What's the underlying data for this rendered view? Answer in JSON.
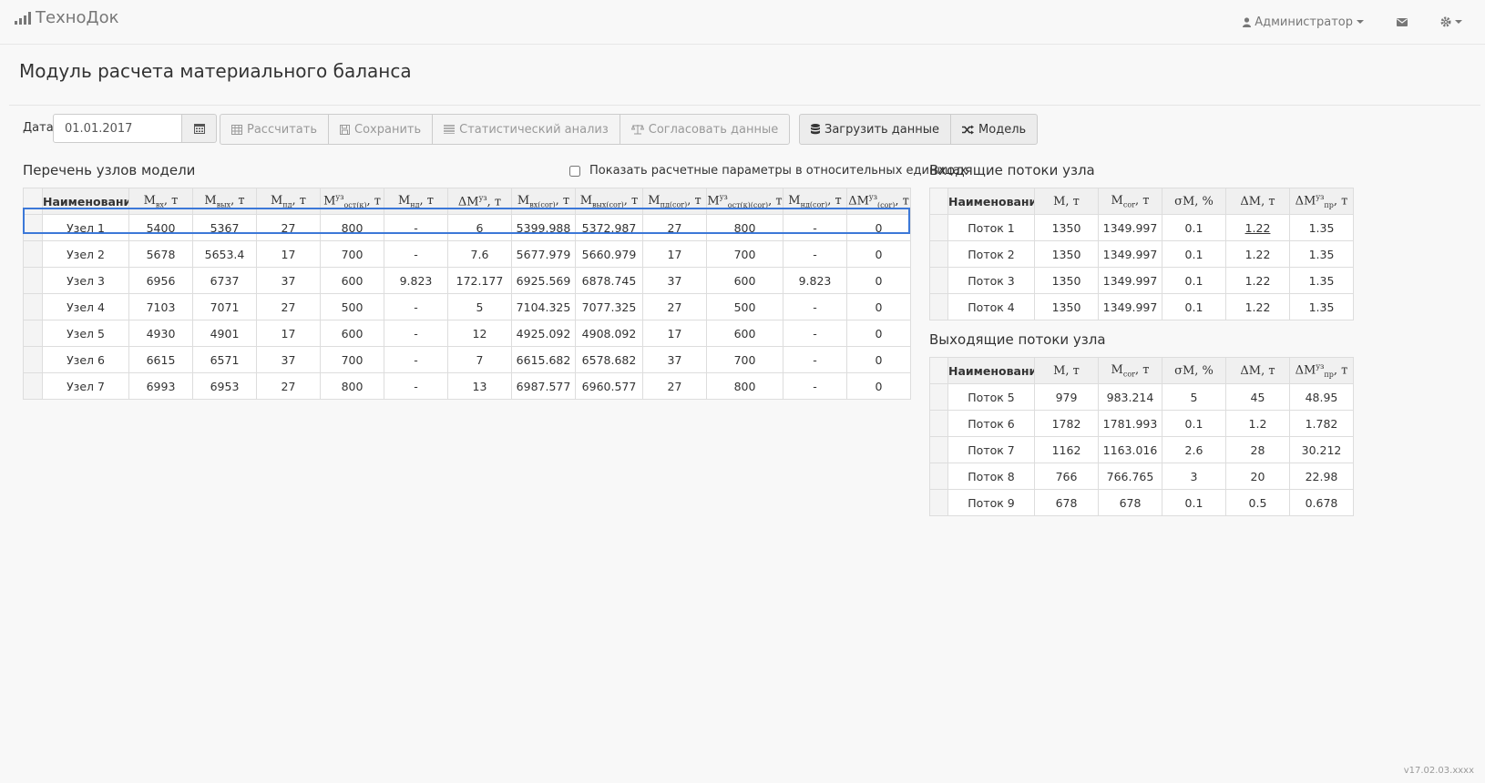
{
  "navbar": {
    "brand": "ТехноДок",
    "user_label": "Администратор",
    "mail_icon": "envelope-icon",
    "settings_icon": "gear-icon"
  },
  "page": {
    "title": "Модуль расчета материального баланса"
  },
  "toolbar": {
    "date_label": "Дата",
    "date_value": "01.01.2017",
    "calc_label": "Рассчитать",
    "save_label": "Сохранить",
    "stat_label": "Статистический анализ",
    "reconcile_label": "Согласовать данные",
    "load_label": "Загрузить данные",
    "model_label": "Модель"
  },
  "nodes": {
    "title": "Перечень узлов модели",
    "relative_checkbox_label": "Показать расчетные параметры в относительных единицах",
    "rows": [
      {
        "name": "Узел 1",
        "m_in": "5400",
        "m_out": "5367",
        "m_pd": "27",
        "m_ost": "800",
        "m_nd": "-",
        "dm": "6",
        "m_in_cor": "5399.988",
        "m_out_cor": "5372.987",
        "m_pd_cor": "27",
        "m_ost_cor": "800",
        "m_nd_cor": "-",
        "dm_cor": "0"
      },
      {
        "name": "Узел 2",
        "m_in": "5678",
        "m_out": "5653.4",
        "m_pd": "17",
        "m_ost": "700",
        "m_nd": "-",
        "dm": "7.6",
        "m_in_cor": "5677.979",
        "m_out_cor": "5660.979",
        "m_pd_cor": "17",
        "m_ost_cor": "700",
        "m_nd_cor": "-",
        "dm_cor": "0"
      },
      {
        "name": "Узел 3",
        "m_in": "6956",
        "m_out": "6737",
        "m_pd": "37",
        "m_ost": "600",
        "m_nd": "9.823",
        "dm": "172.177",
        "m_in_cor": "6925.569",
        "m_out_cor": "6878.745",
        "m_pd_cor": "37",
        "m_ost_cor": "600",
        "m_nd_cor": "9.823",
        "dm_cor": "0"
      },
      {
        "name": "Узел 4",
        "m_in": "7103",
        "m_out": "7071",
        "m_pd": "27",
        "m_ost": "500",
        "m_nd": "-",
        "dm": "5",
        "m_in_cor": "7104.325",
        "m_out_cor": "7077.325",
        "m_pd_cor": "27",
        "m_ost_cor": "500",
        "m_nd_cor": "-",
        "dm_cor": "0"
      },
      {
        "name": "Узел 5",
        "m_in": "4930",
        "m_out": "4901",
        "m_pd": "17",
        "m_ost": "600",
        "m_nd": "-",
        "dm": "12",
        "m_in_cor": "4925.092",
        "m_out_cor": "4908.092",
        "m_pd_cor": "17",
        "m_ost_cor": "600",
        "m_nd_cor": "-",
        "dm_cor": "0"
      },
      {
        "name": "Узел 6",
        "m_in": "6615",
        "m_out": "6571",
        "m_pd": "37",
        "m_ost": "700",
        "m_nd": "-",
        "dm": "7",
        "m_in_cor": "6615.682",
        "m_out_cor": "6578.682",
        "m_pd_cor": "37",
        "m_ost_cor": "700",
        "m_nd_cor": "-",
        "dm_cor": "0"
      },
      {
        "name": "Узел 7",
        "m_in": "6993",
        "m_out": "6953",
        "m_pd": "27",
        "m_ost": "800",
        "m_nd": "-",
        "dm": "13",
        "m_in_cor": "6987.577",
        "m_out_cor": "6960.577",
        "m_pd_cor": "27",
        "m_ost_cor": "800",
        "m_nd_cor": "-",
        "dm_cor": "0"
      }
    ]
  },
  "incoming": {
    "title": "Входящие потоки узла",
    "rows": [
      {
        "name": "Поток 1",
        "m": "1350",
        "m_cor": "1349.997",
        "sigma": "0.1",
        "dm": "1.22",
        "dm_pr": "1.35"
      },
      {
        "name": "Поток 2",
        "m": "1350",
        "m_cor": "1349.997",
        "sigma": "0.1",
        "dm": "1.22",
        "dm_pr": "1.35"
      },
      {
        "name": "Поток 3",
        "m": "1350",
        "m_cor": "1349.997",
        "sigma": "0.1",
        "dm": "1.22",
        "dm_pr": "1.35"
      },
      {
        "name": "Поток 4",
        "m": "1350",
        "m_cor": "1349.997",
        "sigma": "0.1",
        "dm": "1.22",
        "dm_pr": "1.35"
      }
    ]
  },
  "outgoing": {
    "title": "Выходящие потоки узла",
    "rows": [
      {
        "name": "Поток 5",
        "m": "979",
        "m_cor": "983.214",
        "sigma": "5",
        "dm": "45",
        "dm_pr": "48.95"
      },
      {
        "name": "Поток 6",
        "m": "1782",
        "m_cor": "1781.993",
        "sigma": "0.1",
        "dm": "1.2",
        "dm_pr": "1.782"
      },
      {
        "name": "Поток 7",
        "m": "1162",
        "m_cor": "1163.016",
        "sigma": "2.6",
        "dm": "28",
        "dm_pr": "30.212"
      },
      {
        "name": "Поток 8",
        "m": "766",
        "m_cor": "766.765",
        "sigma": "3",
        "dm": "20",
        "dm_pr": "22.98"
      },
      {
        "name": "Поток 9",
        "m": "678",
        "m_cor": "678",
        "sigma": "0.1",
        "dm": "0.5",
        "dm_pr": "0.678"
      }
    ]
  },
  "version": "v17.02.03.xxxx"
}
